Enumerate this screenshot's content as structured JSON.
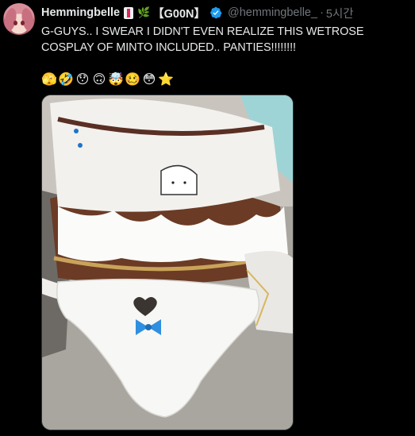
{
  "tweet": {
    "display_name": "Hemmingbelle",
    "badge_emoji": "🌿",
    "tag": "【G00N】",
    "handle": "@hemmingbelle_",
    "separator": "·",
    "time": "5시간",
    "text": "G-GUYS.. I SWEAR I DIDN'T EVEN REALIZE THIS WETROSE COSPLAY OF MINTO INCLUDED.. PANTIES!!!!!!!!",
    "emojis": [
      "🫣",
      "🤣",
      "😯",
      "🙃",
      "🤯",
      "🥴",
      "😳",
      "⭐"
    ],
    "media_alt_icon": "photo-icon"
  },
  "colors": {
    "background": "#000000",
    "text_primary": "#e7e9ea",
    "text_secondary": "#71767b",
    "verified": "#1d9bf0",
    "bookmark_red": "#e0245e"
  }
}
